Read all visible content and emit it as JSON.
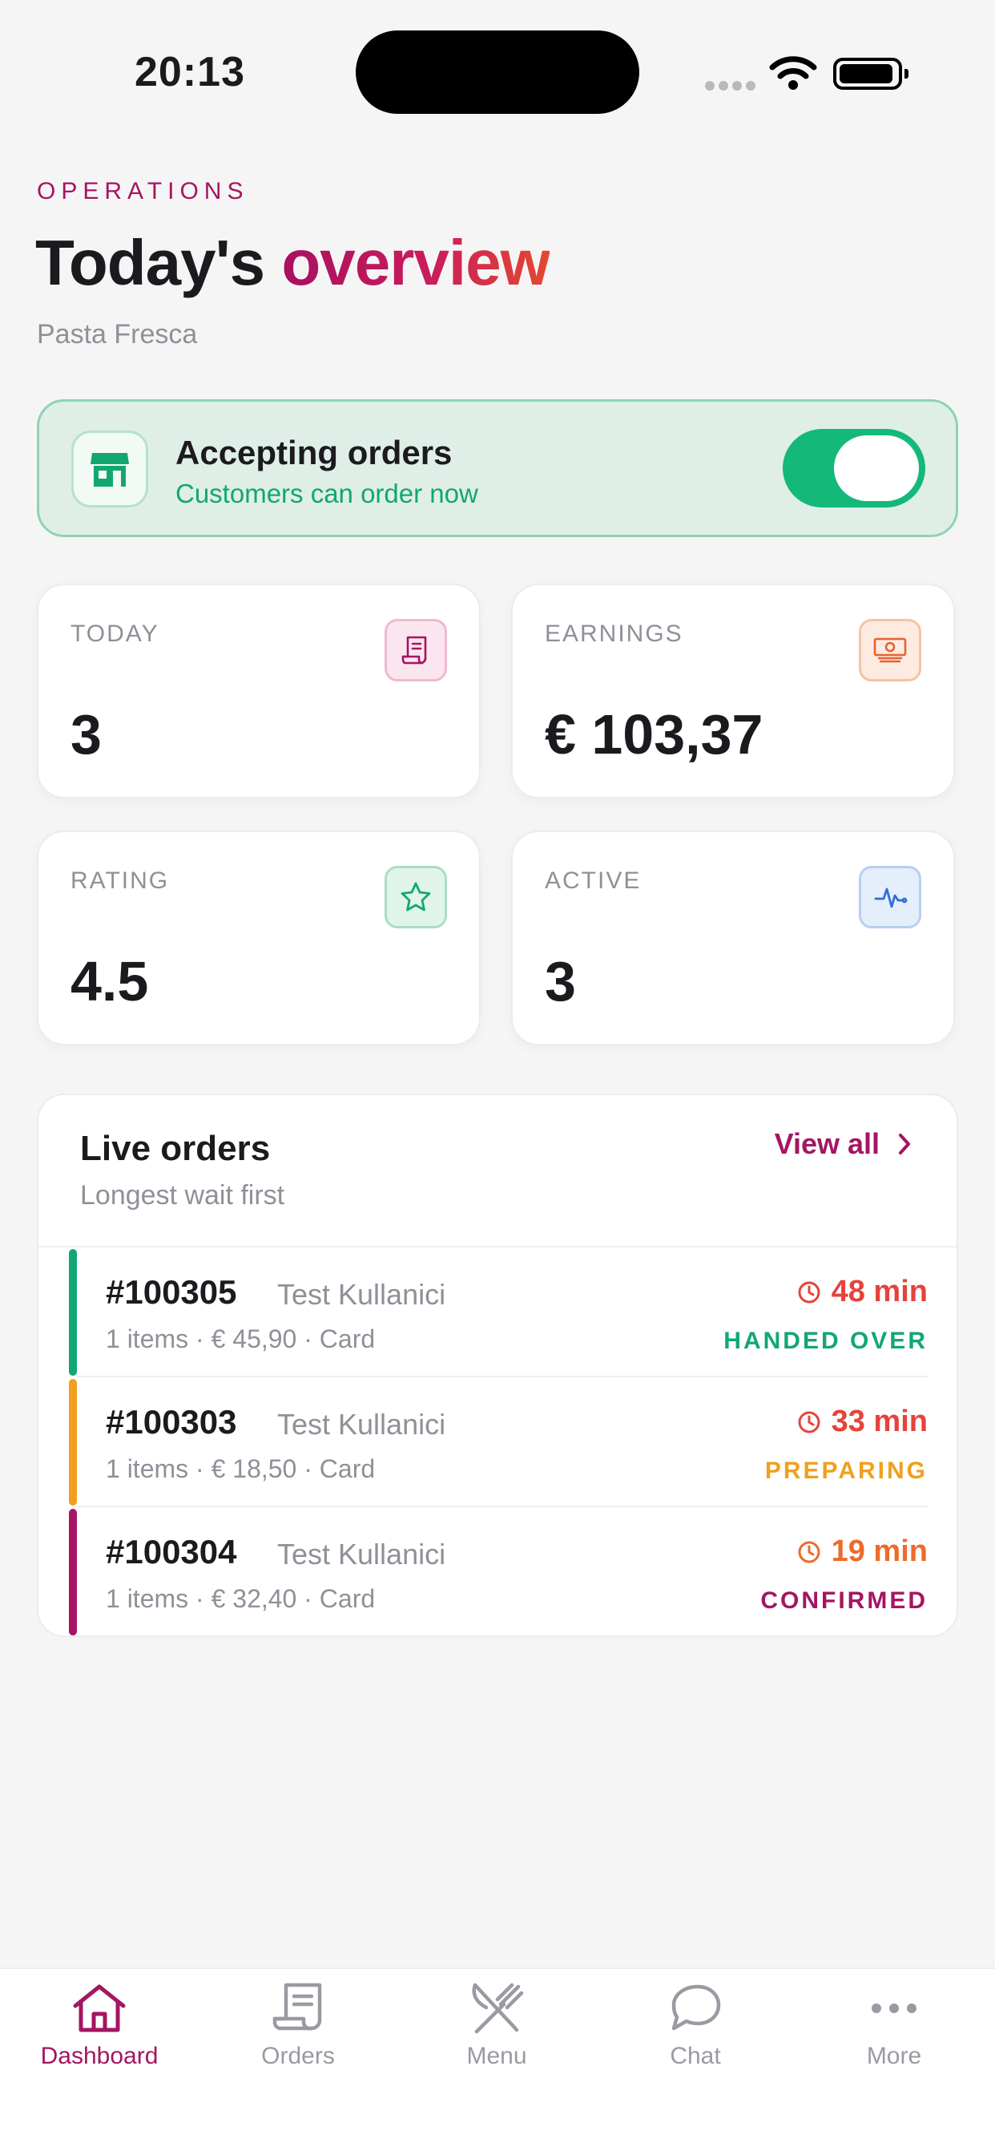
{
  "status_bar": {
    "time": "20:13"
  },
  "header": {
    "eyebrow": "OPERATIONS",
    "title_plain": "Today's ",
    "title_accent": "overview",
    "restaurant": "Pasta Fresca"
  },
  "accepting": {
    "title": "Accepting orders",
    "subtitle": "Customers can order now",
    "enabled": true,
    "icon": "store-icon"
  },
  "stats": [
    {
      "label": "TODAY",
      "value": "3",
      "icon": "receipt-icon"
    },
    {
      "label": "EARNINGS",
      "value": "€ 103,37",
      "icon": "cash-icon"
    },
    {
      "label": "RATING",
      "value": "4.5",
      "icon": "star-icon"
    },
    {
      "label": "ACTIVE",
      "value": "3",
      "icon": "pulse-icon"
    }
  ],
  "live_orders": {
    "title": "Live orders",
    "subtitle": "Longest wait first",
    "view_all": "View all",
    "orders": [
      {
        "id": "#100305",
        "customer": "Test Kullanici",
        "meta": "1 items · € 45,90 · Card",
        "wait": "48 min",
        "status": "HANDED OVER",
        "status_color": "#12A772",
        "bar_color": "#12A772",
        "wait_color": "#E5433B"
      },
      {
        "id": "#100303",
        "customer": "Test Kullanici",
        "meta": "1 items · € 18,50 · Card",
        "wait": "33 min",
        "status": "PREPARING",
        "status_color": "#F0A01E",
        "bar_color": "#F0A01E",
        "wait_color": "#E5433B"
      },
      {
        "id": "#100304",
        "customer": "Test Kullanici",
        "meta": "1 items · € 32,40 · Card",
        "wait": "19 min",
        "status": "CONFIRMED",
        "status_color": "#A51562",
        "bar_color": "#A51562",
        "wait_color": "#EE6A2B"
      }
    ]
  },
  "tabs": [
    {
      "label": "Dashboard",
      "icon": "home-icon",
      "active": true
    },
    {
      "label": "Orders",
      "icon": "receipt-icon",
      "active": false
    },
    {
      "label": "Menu",
      "icon": "fork-knife-icon",
      "active": false
    },
    {
      "label": "Chat",
      "icon": "chat-bubble-icon",
      "active": false
    },
    {
      "label": "More",
      "icon": "more-dots-icon",
      "active": false
    }
  ],
  "colors": {
    "brand": "#A51562",
    "success": "#12A772",
    "warning": "#F0A01E",
    "danger": "#E5433B",
    "muted": "#8F9098",
    "background": "#F6F5F6"
  }
}
